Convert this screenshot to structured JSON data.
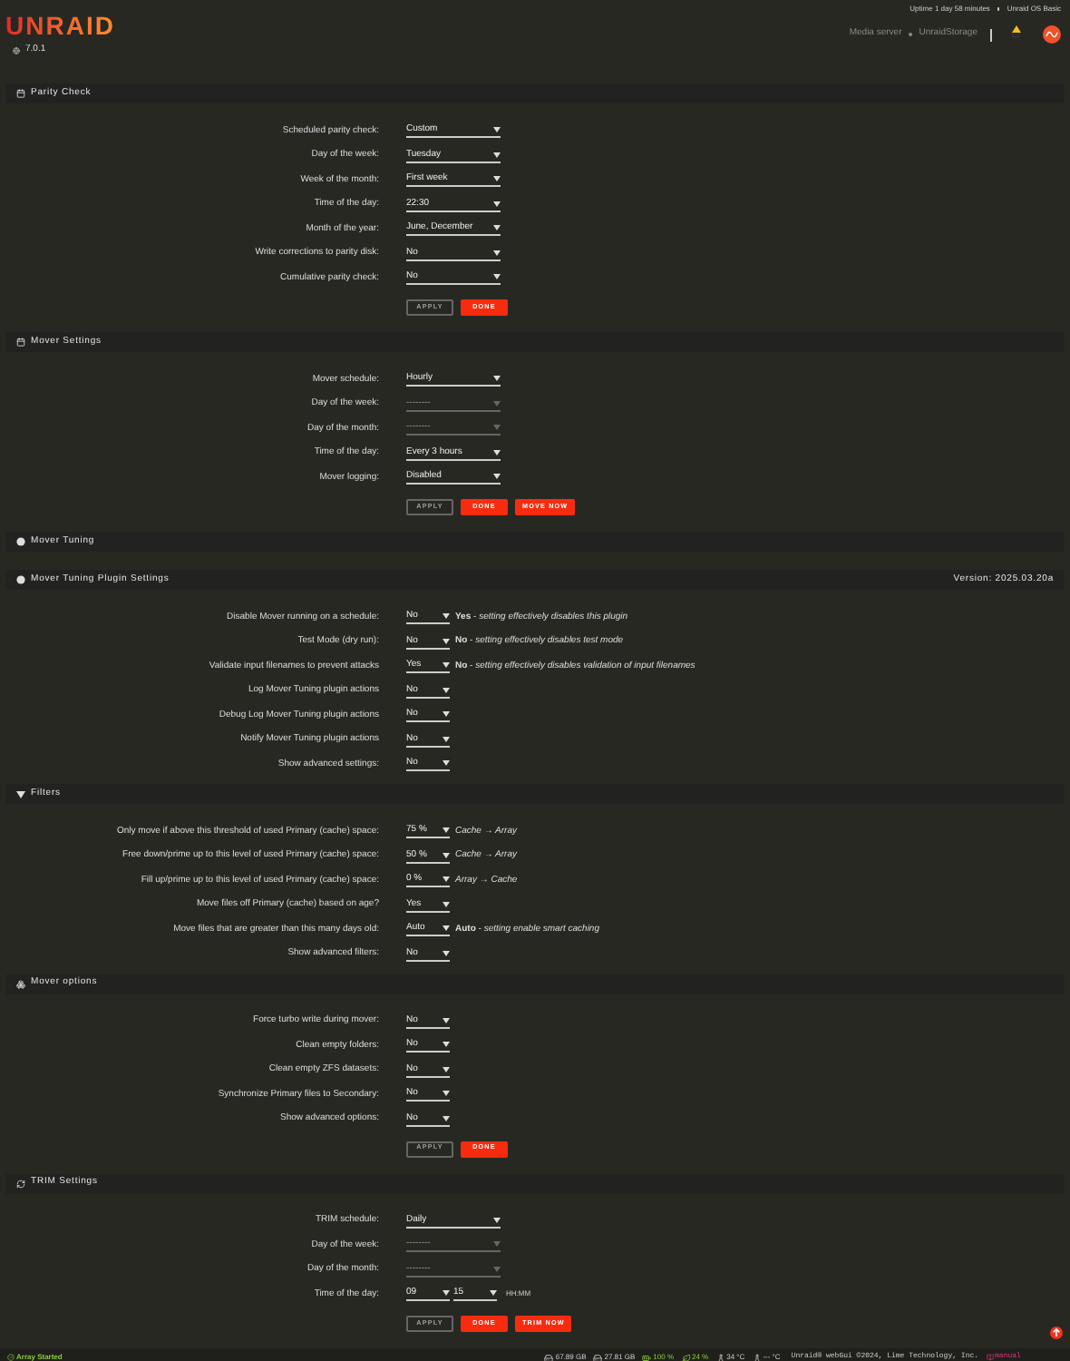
{
  "header": {
    "logo": "UNRAID",
    "version": "7.0.1",
    "uptime": "Uptime 1 day 58 minutes",
    "edition": "Unraid OS Basic",
    "server_description": "Media server",
    "server_name": "UnraidStorage"
  },
  "sections": [
    {
      "title": "Parity Check",
      "rows": [
        {
          "label": "Scheduled parity check:",
          "kind": "select",
          "value": "Custom",
          "disabled": false
        },
        {
          "label": "Day of the week:",
          "kind": "select",
          "value": "Tuesday",
          "disabled": false
        },
        {
          "label": "Week of the month:",
          "kind": "select",
          "value": "First week",
          "disabled": false
        },
        {
          "label": "Time of the day:",
          "kind": "select",
          "value": "22:30",
          "disabled": false
        },
        {
          "label": "Month of the year:",
          "kind": "select",
          "value": "June, December",
          "disabled": false
        },
        {
          "label": "Write corrections to parity disk:",
          "kind": "select",
          "value": "No",
          "disabled": false
        },
        {
          "label": "Cumulative parity check:",
          "kind": "select",
          "value": "No",
          "disabled": false
        }
      ],
      "buttons": [
        {
          "label": "APPLY",
          "kind": "apply"
        },
        {
          "label": "DONE",
          "kind": "primary"
        }
      ]
    },
    {
      "title": "Mover Settings",
      "rows": [
        {
          "label": "Mover schedule:",
          "kind": "select",
          "value": "Hourly",
          "disabled": false
        },
        {
          "label": "Day of the week:",
          "kind": "select",
          "value": "--------",
          "disabled": true
        },
        {
          "label": "Day of the month:",
          "kind": "select",
          "value": "--------",
          "disabled": true
        },
        {
          "label": "Time of the day:",
          "kind": "select",
          "value": "Every 3 hours",
          "disabled": false
        },
        {
          "label": "Mover logging:",
          "kind": "select",
          "value": "Disabled",
          "disabled": false
        }
      ],
      "buttons": [
        {
          "label": "APPLY",
          "kind": "apply"
        },
        {
          "label": "DONE",
          "kind": "primary"
        },
        {
          "label": "MOVE NOW",
          "kind": "primary"
        }
      ]
    },
    {
      "title": "Mover Tuning"
    },
    {
      "title": "Mover Tuning Plugin Settings",
      "version": "Version: 2025.03.20a",
      "rows": [
        {
          "label": "Disable Mover running on a schedule:",
          "kind": "select",
          "value": "No",
          "disabled": false,
          "note": "**Yes** - *setting effectively disables this plugin*"
        },
        {
          "label": "Test Mode (dry run):",
          "kind": "select",
          "value": "No",
          "disabled": false,
          "note": "**No** - *setting effectively disables test mode*"
        },
        {
          "label": "Validate input filenames to prevent attacks",
          "kind": "select",
          "value": "Yes",
          "disabled": false,
          "note": "**No** - *setting effectively disables validation of input filenames*"
        },
        {
          "label": "Log Mover Tuning plugin actions",
          "kind": "select",
          "value": "No",
          "disabled": false
        },
        {
          "label": "Debug Log Mover Tuning plugin actions",
          "kind": "select",
          "value": "No",
          "disabled": false
        },
        {
          "label": "Notify Mover Tuning plugin actions",
          "kind": "select",
          "value": "No",
          "disabled": false
        },
        {
          "label": "Show advanced settings:",
          "kind": "select",
          "value": "No",
          "disabled": false
        }
      ]
    },
    {
      "title": "Filters",
      "rows": [
        {
          "label": "Only move if above this threshold of used Primary (cache) space:",
          "kind": "select",
          "value": "75 %",
          "disabled": false,
          "hint": "Cache → Array"
        },
        {
          "label": "Free down/prime up to this level of used Primary (cache) space:",
          "kind": "select",
          "value": "50 %",
          "disabled": false,
          "hint": "Cache → Array"
        },
        {
          "label": "Fill up/prime up to this level of used Primary (cache) space:",
          "kind": "select",
          "value": "0 %",
          "disabled": false,
          "hint": "Array → Cache"
        },
        {
          "label": "Move files off Primary (cache) based on age?",
          "kind": "select",
          "value": "Yes",
          "disabled": false
        },
        {
          "label": "Move files that are greater than this many days old:",
          "kind": "select",
          "value": "Auto",
          "disabled": false,
          "note": "**Auto** - *setting enable smart caching*"
        },
        {
          "label": "Show advanced filters:",
          "kind": "select",
          "value": "No",
          "disabled": false
        }
      ]
    },
    {
      "title": "Mover options",
      "rows": [
        {
          "label": "Force turbo write during mover:",
          "kind": "select",
          "value": "No",
          "disabled": false
        },
        {
          "label": "Clean empty folders:",
          "kind": "select",
          "value": "No",
          "disabled": false
        },
        {
          "label": "Clean empty ZFS datasets:",
          "kind": "select",
          "value": "No",
          "disabled": false
        },
        {
          "label": "Synchronize Primary files to Secondary:",
          "kind": "select",
          "value": "No",
          "disabled": false
        },
        {
          "label": "Show advanced options:",
          "kind": "select",
          "value": "No",
          "disabled": false
        }
      ],
      "buttons": [
        {
          "label": "APPLY",
          "kind": "apply"
        },
        {
          "label": "DONE",
          "kind": "primary"
        }
      ]
    },
    {
      "title": "TRIM Settings",
      "rows": [
        {
          "label": "TRIM schedule:",
          "kind": "select",
          "value": "Daily",
          "disabled": false
        },
        {
          "label": "Day of the week:",
          "kind": "select",
          "value": "--------",
          "disabled": true
        },
        {
          "label": "Day of the month:",
          "kind": "select",
          "value": "--------",
          "disabled": true
        },
        {
          "label": "Time of the day:",
          "kind": "time",
          "values": [
            "09",
            "15"
          ],
          "unit": "HH:MM",
          "disabled": false
        }
      ],
      "buttons": [
        {
          "label": "APPLY",
          "kind": "apply"
        },
        {
          "label": "DONE",
          "kind": "primary"
        },
        {
          "label": "TRIM NOW",
          "kind": "primary"
        }
      ]
    }
  ],
  "footer": {
    "status": "Array Started",
    "stats": [
      {
        "kind": "drive",
        "text": "67.89 GB"
      },
      {
        "kind": "drive",
        "text": "27.81 GB"
      },
      {
        "kind": "battery",
        "text": "100 %"
      },
      {
        "kind": "leaf",
        "text": "24 %"
      },
      {
        "kind": "temp",
        "text": "34 °C"
      },
      {
        "kind": "temp",
        "text": "--- °C"
      }
    ],
    "copyright": "Unraid® webGui ©2024, Lime Technology, Inc.",
    "manual": "manual"
  }
}
